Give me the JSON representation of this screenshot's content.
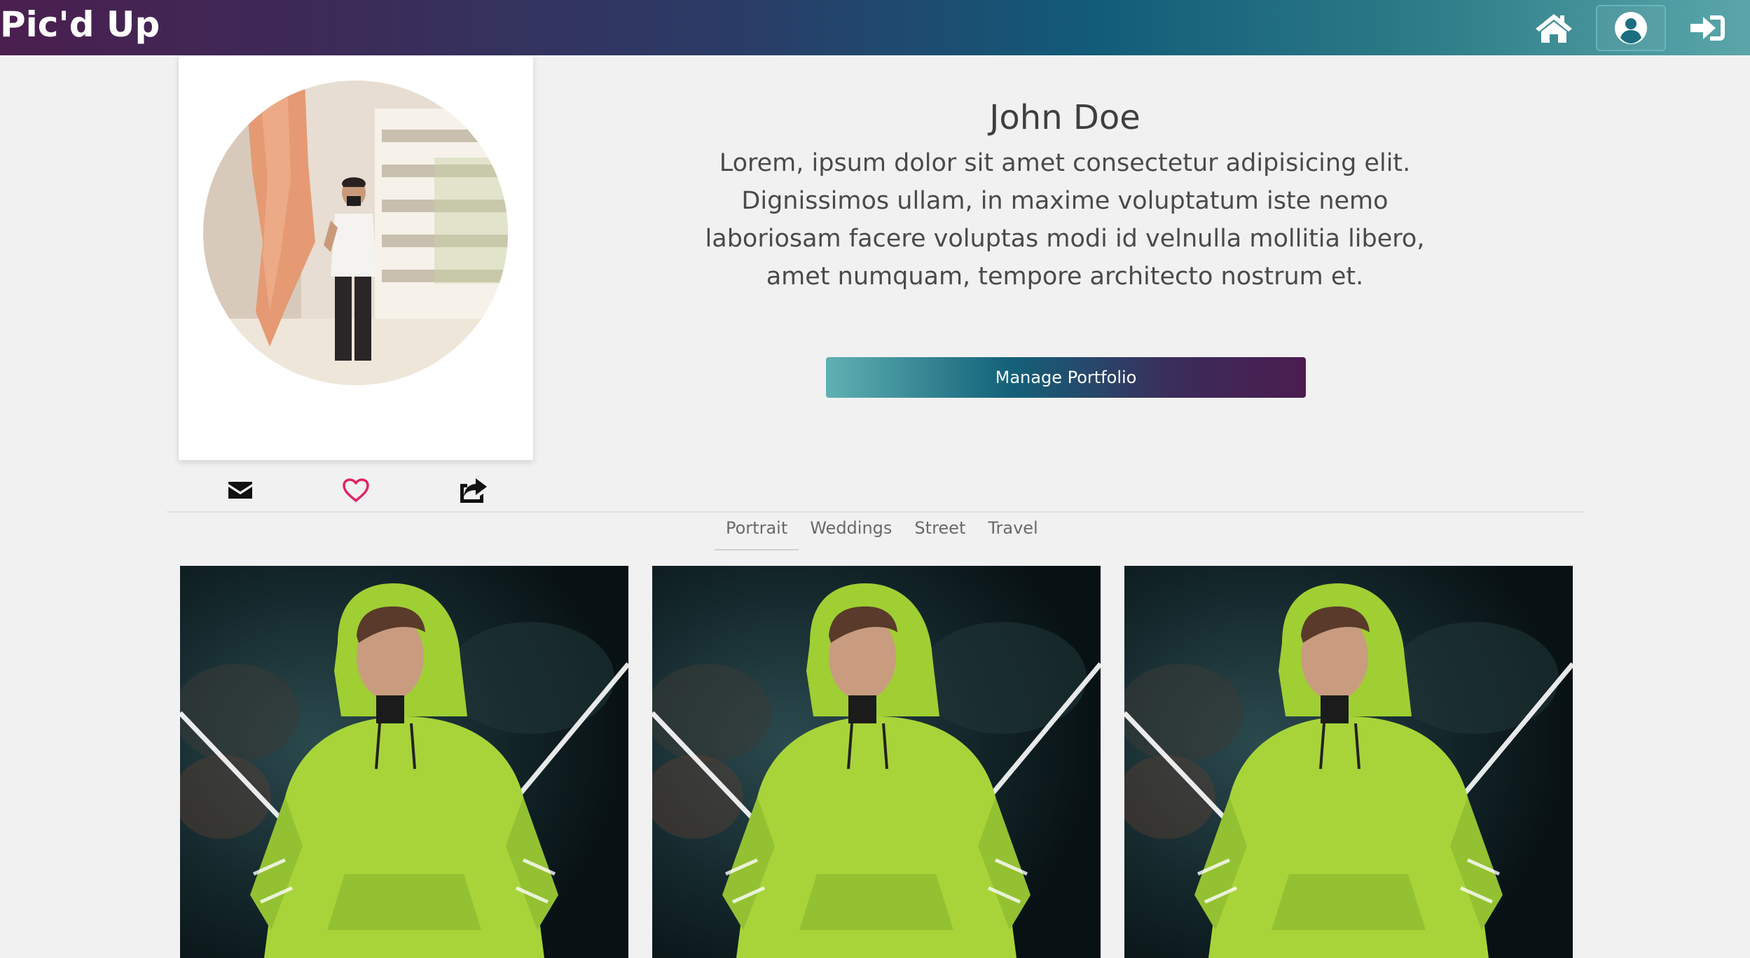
{
  "navbar": {
    "brand": "Pic'd Up",
    "icons": [
      "home-icon",
      "user-circle-icon",
      "sign-in-icon"
    ],
    "active": "user-circle-icon"
  },
  "profile": {
    "name": "John Doe",
    "bio": "Lorem, ipsum dolor sit amet consectetur adipisicing elit. Dignissimos ullam, in maxime voluptatum iste nemo laboriosam facere voluptas modi id velnulla mollitia libero, amet numquam, tempore architecto nostrum et.",
    "manage_button": "Manage Portfolio",
    "card_actions": [
      "envelope-icon",
      "heart-icon",
      "share-icon"
    ],
    "heart_color": "#e0245e"
  },
  "tabs": {
    "items": [
      "Portrait",
      "Weddings",
      "Street",
      "Travel"
    ],
    "active": "Portrait"
  },
  "gallery": {
    "items": [
      {
        "subject": "person in neon green hoodie"
      },
      {
        "subject": "person in neon green hoodie"
      },
      {
        "subject": "person in neon green hoodie"
      }
    ]
  },
  "colors": {
    "gradient_start": "#4a1f4f",
    "gradient_end": "#5aa6aa",
    "page_bg": "#f1f1f1",
    "hoodie": "#a8d43a"
  }
}
